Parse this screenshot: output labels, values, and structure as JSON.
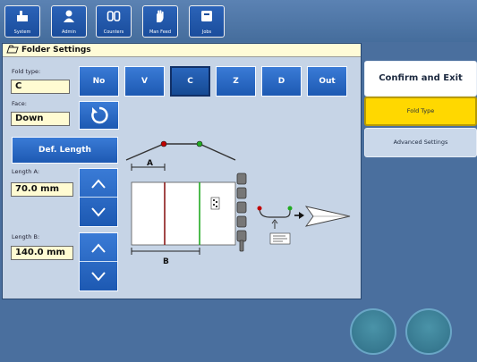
{
  "toolbar": {
    "buttons": [
      {
        "label": "System",
        "icon": "system-icon"
      },
      {
        "label": "Admin",
        "icon": "user-icon"
      },
      {
        "label": "Counters",
        "icon": "counter-icon"
      },
      {
        "label": "Man Feed",
        "icon": "hand-icon"
      },
      {
        "label": "Jobs",
        "icon": "jobs-icon"
      }
    ]
  },
  "panel": {
    "title": "Folder Settings",
    "fold_type_label": "Fold type:",
    "fold_type_value": "C",
    "face_label": "Face:",
    "face_value": "Down",
    "fold_options": [
      "No",
      "V",
      "C",
      "Z",
      "D",
      "Out"
    ],
    "selected_fold": "C",
    "def_length_label": "Def. Length",
    "length_a_label": "Length A:",
    "length_a_value": "70.0 mm",
    "length_b_label": "Length B:",
    "length_b_value": "140.0 mm",
    "diagram_label_a": "A",
    "diagram_label_b": "B"
  },
  "side": {
    "confirm_label": "Confirm and Exit",
    "fold_type_tab": "Fold Type",
    "advanced_tab": "Advanced Settings"
  },
  "colors": {
    "accent_yellow": "#ffd800",
    "button_blue": "#2b6bc7",
    "panel_bg": "#c6d4e6",
    "value_bg": "#fffbd2"
  }
}
